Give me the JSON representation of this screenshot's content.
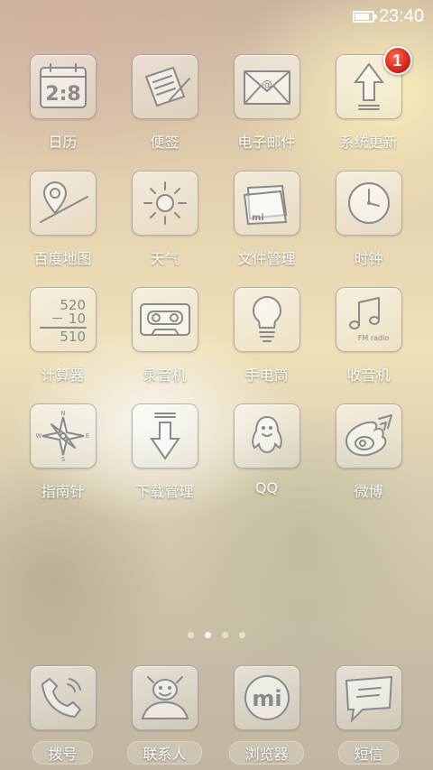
{
  "status_bar": {
    "time": "23:40",
    "battery_level": 0.85
  },
  "apps": [
    {
      "label": "日历",
      "icon": "calendar-icon",
      "calendar_text": "2:8"
    },
    {
      "label": "便签",
      "icon": "notepad-icon"
    },
    {
      "label": "电子邮件",
      "icon": "email-icon"
    },
    {
      "label": "系统更新",
      "icon": "update-arrow-icon",
      "badge": "1"
    },
    {
      "label": "百度地图",
      "icon": "map-pin-icon"
    },
    {
      "label": "天气",
      "icon": "sun-icon"
    },
    {
      "label": "文件管理",
      "icon": "folder-icon",
      "folder_text": "mi"
    },
    {
      "label": "时钟",
      "icon": "clock-icon"
    },
    {
      "label": "计算器",
      "icon": "calculator-icon",
      "calc_lines": [
        "520",
        "－ 10",
        "510"
      ]
    },
    {
      "label": "录音机",
      "icon": "cassette-icon"
    },
    {
      "label": "手电筒",
      "icon": "lightbulb-icon"
    },
    {
      "label": "收音机",
      "icon": "music-note-icon",
      "radio_text": "FM radio"
    },
    {
      "label": "指南针",
      "icon": "compass-icon",
      "compass_letters": [
        "N",
        "E",
        "S",
        "W"
      ]
    },
    {
      "label": "下载管理",
      "icon": "download-arrow-icon"
    },
    {
      "label": "QQ",
      "icon": "penguin-icon"
    },
    {
      "label": "微博",
      "icon": "weibo-eye-icon"
    }
  ],
  "pager": {
    "pages": 4,
    "current": 2
  },
  "dock": [
    {
      "label": "拨号",
      "icon": "phone-icon"
    },
    {
      "label": "联系人",
      "icon": "contact-person-icon"
    },
    {
      "label": "浏览器",
      "icon": "mi-browser-icon",
      "logo_text": "mi"
    },
    {
      "label": "短信",
      "icon": "message-bubble-icon"
    }
  ]
}
